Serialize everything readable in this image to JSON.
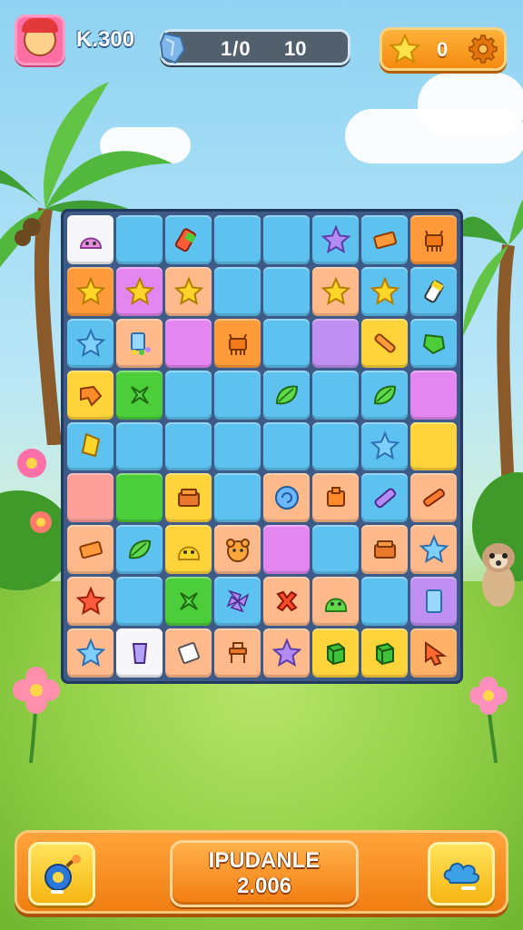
{
  "hud": {
    "score_text": "K.300",
    "moves_current": "1/0",
    "moves_target": "10",
    "stars_count": "0",
    "icons": {
      "avatar": "player-avatar-icon",
      "crystal": "crystal-icon",
      "star": "star-icon",
      "settings": "gear-icon"
    }
  },
  "board": {
    "rows": 9,
    "cols": 8,
    "tiles": [
      [
        [
          "white",
          "slime"
        ],
        [
          "blue",
          ""
        ],
        [
          "blue",
          "battery"
        ],
        [
          "blue",
          ""
        ],
        [
          "blue",
          ""
        ],
        [
          "blue",
          "star-lilac"
        ],
        [
          "blue",
          "bar"
        ],
        [
          "orange",
          "creature"
        ]
      ],
      [
        [
          "orange",
          "star"
        ],
        [
          "pink",
          "star"
        ],
        [
          "peach",
          "star"
        ],
        [
          "blue",
          ""
        ],
        [
          "blue",
          ""
        ],
        [
          "peach",
          "star"
        ],
        [
          "blue",
          "star"
        ],
        [
          "blue",
          "glue"
        ]
      ],
      [
        [
          "blue",
          "star-blue"
        ],
        [
          "peach",
          "device"
        ],
        [
          "pink",
          ""
        ],
        [
          "orange",
          "creature"
        ],
        [
          "blue",
          ""
        ],
        [
          "lilac",
          ""
        ],
        [
          "yellow",
          "stick"
        ],
        [
          "blue",
          "gem-green"
        ]
      ],
      [
        [
          "yellow",
          "bolt"
        ],
        [
          "green",
          "cross"
        ],
        [
          "blue",
          ""
        ],
        [
          "blue",
          ""
        ],
        [
          "blue",
          "leaf"
        ],
        [
          "blue",
          ""
        ],
        [
          "blue",
          "leaf"
        ],
        [
          "pink",
          ""
        ]
      ],
      [
        [
          "blue",
          "gem-yellow"
        ],
        [
          "blue",
          ""
        ],
        [
          "blue",
          ""
        ],
        [
          "blue",
          ""
        ],
        [
          "blue",
          ""
        ],
        [
          "blue",
          ""
        ],
        [
          "blue",
          "star-blue"
        ],
        [
          "yellow",
          ""
        ]
      ],
      [
        [
          "salmon",
          ""
        ],
        [
          "green",
          ""
        ],
        [
          "yellow",
          "box"
        ],
        [
          "blue",
          ""
        ],
        [
          "peach",
          "swirl"
        ],
        [
          "peach",
          "block"
        ],
        [
          "blue",
          "pencil"
        ],
        [
          "peach",
          "bone"
        ]
      ],
      [
        [
          "peach",
          "bar"
        ],
        [
          "blue",
          "leaf"
        ],
        [
          "yellow",
          "slime-yellow"
        ],
        [
          "peach",
          "bear"
        ],
        [
          "pink",
          ""
        ],
        [
          "blue",
          ""
        ],
        [
          "peach",
          "box"
        ],
        [
          "peach",
          "star-blue"
        ]
      ],
      [
        [
          "peach",
          "star-red"
        ],
        [
          "blue",
          ""
        ],
        [
          "green",
          "cross"
        ],
        [
          "blue",
          "pinwheel"
        ],
        [
          "peach",
          "x-red"
        ],
        [
          "peach",
          "slime-green"
        ],
        [
          "blue",
          ""
        ],
        [
          "lilac",
          "panel"
        ]
      ],
      [
        [
          "peach",
          "star-blue"
        ],
        [
          "white",
          "cup"
        ],
        [
          "peach",
          "paper"
        ],
        [
          "peach",
          "chair"
        ],
        [
          "peach",
          "star-lilac"
        ],
        [
          "yellow",
          "cube"
        ],
        [
          "yellow",
          "cube"
        ],
        [
          "apricot",
          "arrow"
        ]
      ]
    ]
  },
  "bottom_bar": {
    "center_title": "IPUDANLE",
    "center_value": "2.006",
    "left_button_icon": "bomb-booster-icon",
    "right_button_icon": "cloud-booster-icon"
  },
  "colors": {
    "accent_orange": "#f48a12",
    "board_frame": "#3d5b86",
    "sky": "#8fd3f2",
    "grass": "#95d24a"
  }
}
